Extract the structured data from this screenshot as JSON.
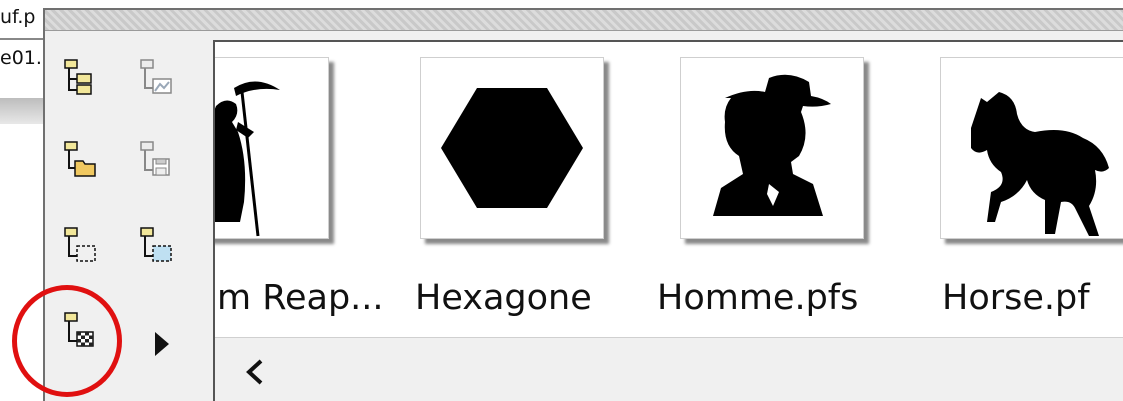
{
  "background_window": {
    "file1": "uf.p",
    "file2": "e01."
  },
  "toolbar": {
    "buttons": [
      {
        "icon": "folder-tree-icon"
      },
      {
        "icon": "folder-image-icon"
      },
      {
        "icon": "folder-open-icon"
      },
      {
        "icon": "folder-save-icon"
      },
      {
        "icon": "folder-selection-icon"
      },
      {
        "icon": "folder-selection-fill-icon"
      },
      {
        "icon": "folder-checker-icon"
      }
    ],
    "expand_icon": "triangle-right-icon"
  },
  "thumbnails": [
    {
      "label": "m Reap...",
      "shape": "grim-reaper"
    },
    {
      "label": "Hexagone",
      "shape": "hexagon"
    },
    {
      "label": "Homme.pfs",
      "shape": "man-with-hat"
    },
    {
      "label": "Horse.pf",
      "shape": "horse"
    }
  ],
  "scroll": {
    "left_glyph": "<"
  },
  "annotation": {
    "color": "#e01010"
  }
}
